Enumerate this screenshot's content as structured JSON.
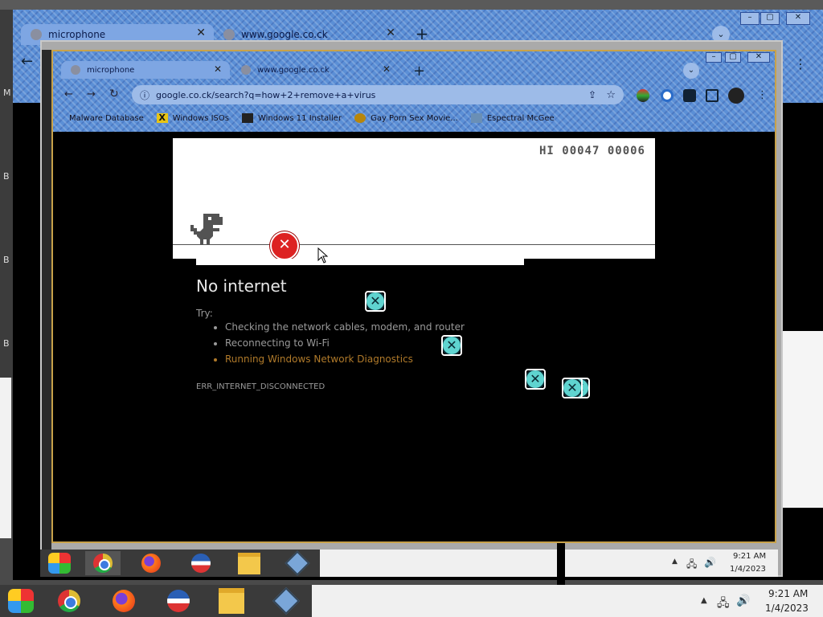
{
  "outer_browser": {
    "tabs": [
      {
        "label": "microphone"
      },
      {
        "label": "www.google.co.ck"
      }
    ]
  },
  "inner_browser": {
    "tabs": [
      {
        "label": "microphone"
      },
      {
        "label": "www.google.co.ck"
      }
    ],
    "address": "google.co.ck/search?q=how+2+remove+a+virus",
    "bookmarks": [
      {
        "label": "Malware Database"
      },
      {
        "label": "Windows ISOs"
      },
      {
        "label": "Windows 11 Installer"
      },
      {
        "label": "Gay Porn Sex Movie..."
      },
      {
        "label": "Espectral McGee"
      }
    ]
  },
  "dino_game": {
    "score_text": "HI 00047 00006"
  },
  "error_page": {
    "title": "No internet",
    "try_label": "Try:",
    "suggestions": [
      "Checking the network cables, modem, and router",
      "Reconnecting to Wi-Fi",
      "Running Windows Network Diagnostics"
    ],
    "error_code": "ERR_INTERNET_DISCONNECTED"
  },
  "inner_taskbar": {
    "time": "9:21 AM",
    "date": "1/4/2023"
  },
  "taskbar": {
    "time": "9:21 AM",
    "date": "1/4/2023"
  },
  "colors": {
    "accent": "#5b8fd6",
    "error_red": "#d22",
    "badge_cyan": "#5fd4d0"
  }
}
